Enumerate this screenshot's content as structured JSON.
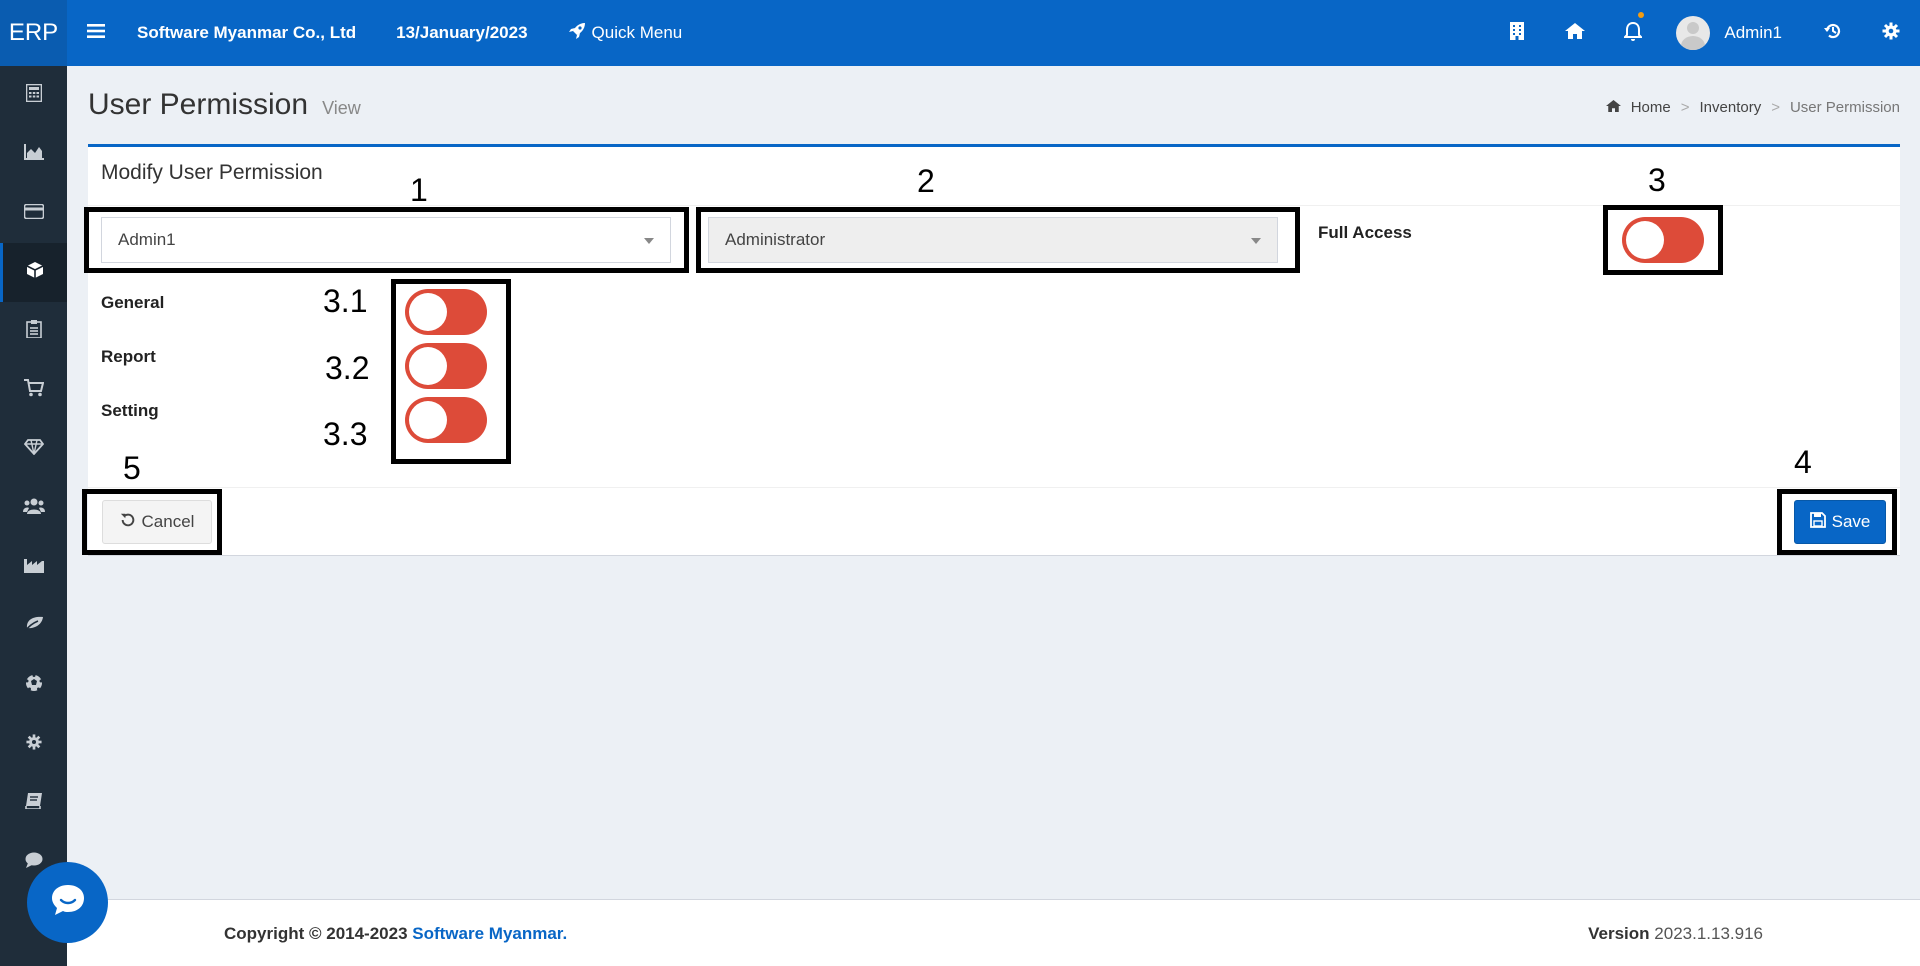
{
  "app": {
    "brand": "ERP",
    "company": "Software Myanmar Co., Ltd",
    "date": "13/January/2023",
    "quick_menu": "Quick Menu",
    "user": "Admin1"
  },
  "sidebar": {
    "items": [
      "calculator-icon",
      "area-chart-icon",
      "credit-card-icon",
      "cube-icon",
      "clipboard-icon",
      "cart-icon",
      "diamond-icon",
      "users-icon",
      "industry-icon",
      "leaf-icon",
      "futbol-icon",
      "gear-icon",
      "book-icon",
      "comment-icon"
    ]
  },
  "page": {
    "title": "User Permission",
    "subtitle": "View"
  },
  "breadcrumb": {
    "home": "Home",
    "sep1": ">",
    "inventory": "Inventory",
    "sep2": ">",
    "current": "User Permission"
  },
  "form": {
    "box_title": "Modify User Permission",
    "user_select": "Admin1",
    "role_select": "Administrator",
    "full_access_label": "Full Access",
    "general_label": "General",
    "report_label": "Report",
    "setting_label": "Setting",
    "cancel_label": "Cancel",
    "save_label": "Save"
  },
  "annotations": {
    "a1": "1",
    "a2": "2",
    "a3": "3",
    "a31": "3.1",
    "a32": "3.2",
    "a33": "3.3",
    "a4": "4",
    "a5": "5"
  },
  "footer": {
    "copyright": "Copyright © 2014-2023 ",
    "company_link": "Software Myanmar.",
    "version_label": "Version",
    "version": "2023.1.13.916"
  },
  "colors": {
    "primary": "#0866c6",
    "sidebar": "#1f2d3a",
    "toggle_off": "#dd4b39"
  }
}
